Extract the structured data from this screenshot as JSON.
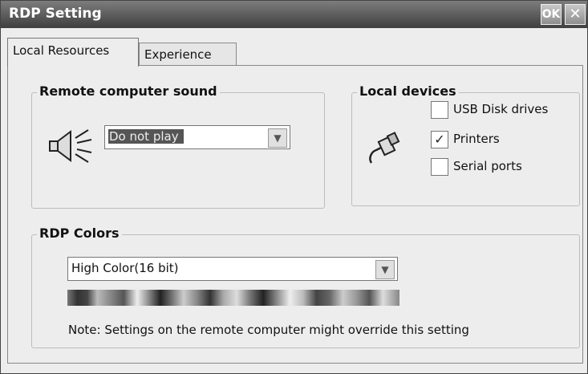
{
  "window": {
    "title": "RDP Setting",
    "ok_label": "OK",
    "close_glyph": "✕"
  },
  "tabs": [
    {
      "label": "Local Resources",
      "active": true
    },
    {
      "label": "Experience",
      "active": false
    }
  ],
  "sound": {
    "legend": "Remote computer sound",
    "icon": "speaker-icon",
    "selected": "Do not play"
  },
  "devices": {
    "legend": "Local devices",
    "icon": "plug-icon",
    "items": [
      {
        "label": "USB Disk drives",
        "checked": false
      },
      {
        "label": "Printers",
        "checked": true
      },
      {
        "label": "Serial ports",
        "checked": false
      }
    ]
  },
  "colors": {
    "legend": "RDP Colors",
    "selected": "High Color(16 bit)",
    "note": "Note: Settings on the remote computer might  override this setting"
  },
  "icons": {
    "dropdown_arrow": "chevron-down-icon",
    "checkmark": "check-icon"
  }
}
